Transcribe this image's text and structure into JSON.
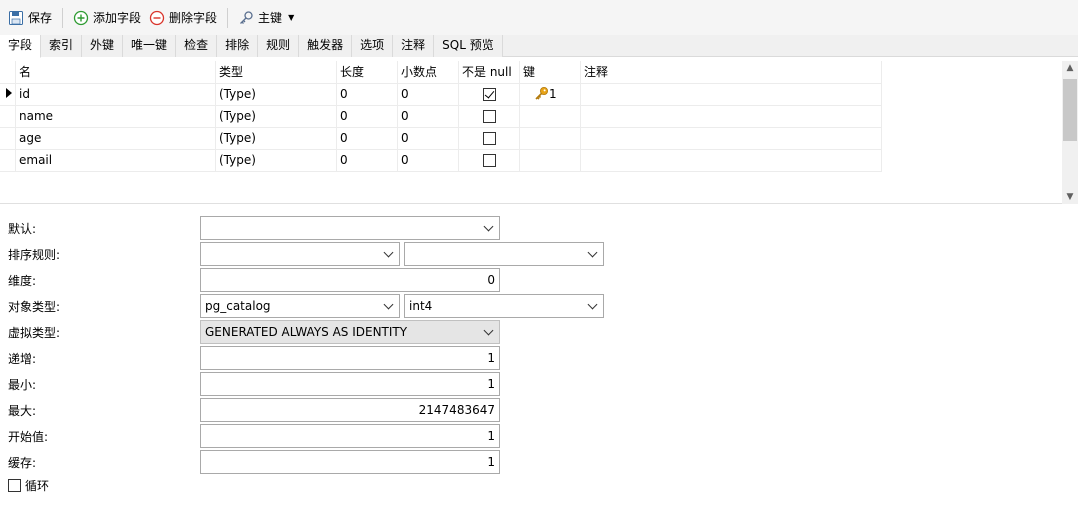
{
  "toolbar": {
    "save": "保存",
    "add_field": "添加字段",
    "delete_field": "删除字段",
    "primary_key": "主键"
  },
  "tabs": [
    "字段",
    "索引",
    "外键",
    "唯一键",
    "检查",
    "排除",
    "规则",
    "触发器",
    "选项",
    "注释",
    "SQL 预览"
  ],
  "grid": {
    "columns": [
      "名",
      "类型",
      "长度",
      "小数点",
      "不是 null",
      "键",
      "注释"
    ],
    "rows": [
      {
        "name": "id",
        "type": "(Type)",
        "length": "0",
        "decimal": "0",
        "not_null": true,
        "key": "1",
        "comment": ""
      },
      {
        "name": "name",
        "type": "(Type)",
        "length": "0",
        "decimal": "0",
        "not_null": false,
        "key": "",
        "comment": ""
      },
      {
        "name": "age",
        "type": "(Type)",
        "length": "0",
        "decimal": "0",
        "not_null": false,
        "key": "",
        "comment": ""
      },
      {
        "name": "email",
        "type": "(Type)",
        "length": "0",
        "decimal": "0",
        "not_null": false,
        "key": "",
        "comment": ""
      }
    ]
  },
  "props": {
    "default_label": "默认:",
    "default_value": "",
    "collation_label": "排序规则:",
    "collation_schema": "",
    "collation_value": "",
    "dimension_label": "维度:",
    "dimension_value": "0",
    "object_type_label": "对象类型:",
    "object_type_schema": "pg_catalog",
    "object_type_value": "int4",
    "virtual_type_label": "虚拟类型:",
    "virtual_type_value": "GENERATED ALWAYS AS IDENTITY",
    "increment_label": "递增:",
    "increment_value": "1",
    "min_label": "最小:",
    "min_value": "1",
    "max_label": "最大:",
    "max_value": "2147483647",
    "start_label": "开始值:",
    "start_value": "1",
    "cache_label": "缓存:",
    "cache_value": "1",
    "cycle_label": "循环",
    "cycle_checked": false
  },
  "colors": {
    "key_gold": "#e8a317",
    "add_green": "#2e9b32",
    "delete_red": "#d9342b",
    "save_blue": "#3a6ea5"
  }
}
